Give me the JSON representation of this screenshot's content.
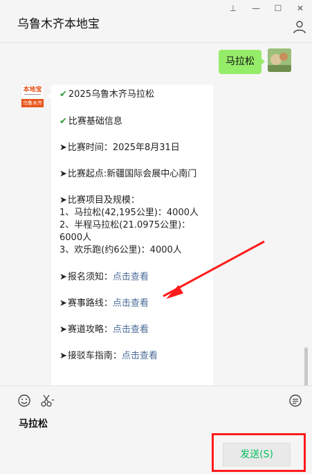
{
  "window": {
    "title": "乌鲁木齐本地宝",
    "pin_glyph": "⊥",
    "minimize_glyph": "—",
    "maximize_glyph": "☐",
    "close_glyph": "✕",
    "user_icon": "user-icon"
  },
  "sent": {
    "text": "马拉松"
  },
  "bot": {
    "avatar_top": "本地宝",
    "avatar_bottom": "乌鲁木齐",
    "lines": [
      {
        "prefix": "✔",
        "text": "2025乌鲁木齐马拉松"
      },
      {
        "prefix": "✔",
        "text": "比赛基础信息"
      },
      {
        "prefix": "➤",
        "text": "比赛时间：2025年8月31日"
      },
      {
        "prefix": "➤",
        "text": "比赛起点:新疆国际会展中心南门"
      },
      {
        "prefix": "➤",
        "text": "比赛项目及规模："
      },
      {
        "prefix": "",
        "text": "1、马拉松(42,195公里)：4000人"
      },
      {
        "prefix": "",
        "text": "2、半程马拉松(21.0975公里)："
      },
      {
        "prefix": "",
        "text": "6000人"
      },
      {
        "prefix": "",
        "text": "3、欢乐跑(约6公里)：4000人"
      },
      {
        "prefix": "➤",
        "text": "报名须知：",
        "link": "点击查看"
      },
      {
        "prefix": "➤",
        "text": "赛事路线：",
        "link": "点击查看"
      },
      {
        "prefix": "➤",
        "text": "赛道攻略：",
        "link": "点击查看"
      },
      {
        "prefix": "➤",
        "text": "接驳车指南：",
        "link": "点击查看"
      }
    ]
  },
  "input": {
    "text": "马拉松",
    "tools": [
      "emoji-icon",
      "scissors-icon",
      "chat-history-icon"
    ]
  },
  "send_button": {
    "label": "发送(S)"
  },
  "colors": {
    "accent_green": "#07c160",
    "bubble_green": "#95ec69",
    "link": "#4c6c98",
    "annotation_red": "#ff1b1b"
  }
}
